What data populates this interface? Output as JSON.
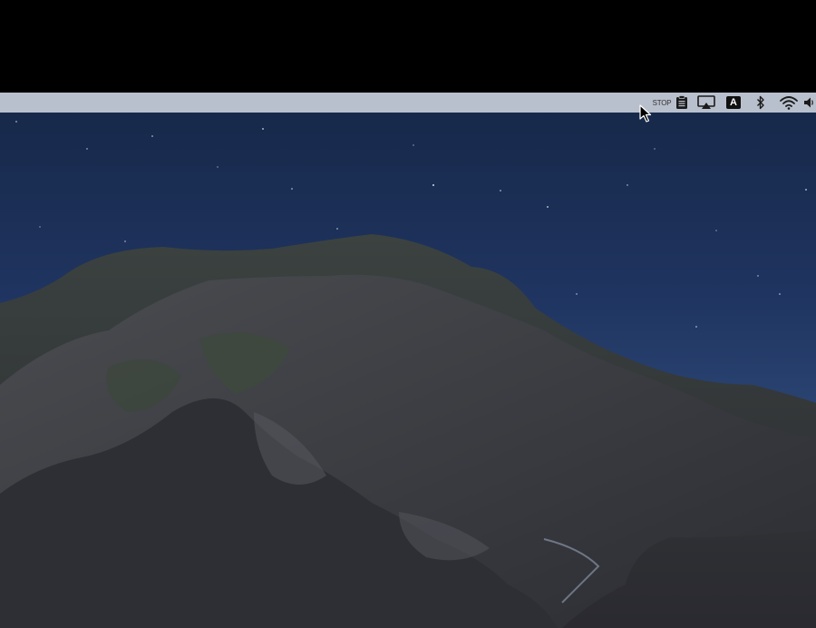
{
  "menubar": {
    "stop_label": "STOP",
    "input_source_label": "A",
    "icons": [
      "clipboard-icon",
      "airplay-icon",
      "bluetooth-icon",
      "wifi-icon",
      "volume-icon"
    ]
  },
  "wallpaper": {
    "name": "mountain-island-night"
  },
  "colors": {
    "menubar_bg": "#b9c0cd",
    "sky_top": "#17294a",
    "sky_bottom": "#3a5584",
    "sea": "#3c5e8a",
    "rock": "#3a3a40"
  }
}
